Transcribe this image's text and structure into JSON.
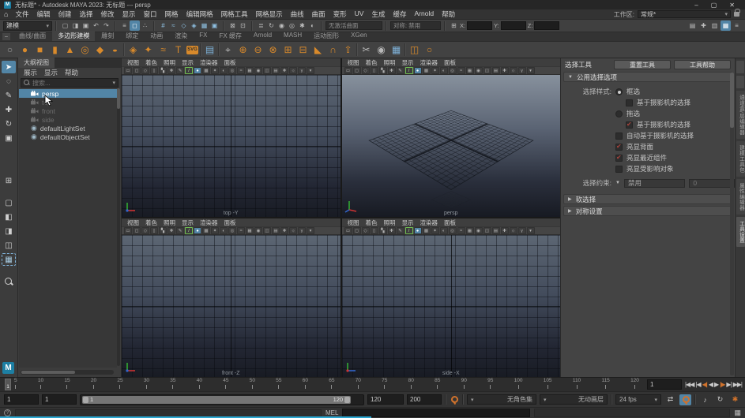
{
  "colors": {
    "accent": "#5285a6",
    "shelf_orange": "#d98a2b",
    "check_red": "#a8433c",
    "autokey_blue": "#5285a6",
    "progress_cyan": "#2ba7d1"
  },
  "title_bar": {
    "title": "无标题* - Autodesk MAYA 2023: 无标题 --- persp",
    "minimize": "–",
    "maximize": "▢",
    "close": "✕"
  },
  "menu_bar": {
    "home_icon": "⌂",
    "items": [
      "文件",
      "编辑",
      "创建",
      "选择",
      "修改",
      "显示",
      "窗口",
      "网格",
      "编辑网格",
      "网格工具",
      "网格显示",
      "曲线",
      "曲面",
      "变形",
      "UV",
      "生成",
      "缓存",
      "Arnold",
      "帮助"
    ],
    "workspace_label": "工作区:",
    "workspace_value": "常规*"
  },
  "status_line": {
    "menu_set": "建模",
    "file_icons": [
      {
        "name": "new-scene-icon",
        "glyph": "▢"
      },
      {
        "name": "open-scene-icon",
        "glyph": "◨"
      },
      {
        "name": "save-scene-icon",
        "glyph": "▣"
      },
      {
        "name": "undo-icon",
        "glyph": "↶"
      },
      {
        "name": "redo-icon",
        "glyph": "↷"
      }
    ],
    "selection_icons": [
      {
        "name": "select-by-hierarchy-icon",
        "glyph": "≡"
      },
      {
        "name": "select-by-object-icon",
        "glyph": "◻",
        "active": true
      },
      {
        "name": "select-by-component-icon",
        "glyph": "∴"
      }
    ],
    "snap_icons": [
      {
        "name": "snap-to-grids-icon",
        "glyph": "#",
        "cls": "blue"
      },
      {
        "name": "snap-to-curves-icon",
        "glyph": "≈",
        "cls": "blue"
      },
      {
        "name": "snap-to-points-icon",
        "glyph": "◇",
        "cls": "blue"
      },
      {
        "name": "snap-to-projected-center-icon",
        "glyph": "◈",
        "cls": "blue"
      },
      {
        "name": "snap-to-view-planes-icon",
        "glyph": "▦",
        "cls": "blue"
      },
      {
        "name": "make-live-icon",
        "glyph": "▣",
        "cls": "blue"
      }
    ],
    "lock_icons": [
      {
        "name": "selection-lock-icon",
        "glyph": "⊠"
      },
      {
        "name": "highlight-selection-icon",
        "glyph": "⊡"
      }
    ],
    "history_icons": [
      {
        "name": "operations-list-icon",
        "glyph": "≣"
      },
      {
        "name": "construction-history-icon",
        "glyph": "↻"
      },
      {
        "name": "render-frame-icon",
        "glyph": "◉"
      },
      {
        "name": "ipr-render-icon",
        "glyph": "◎"
      },
      {
        "name": "render-settings-icon",
        "glyph": "✱"
      },
      {
        "name": "hypershade-icon",
        "glyph": "◐"
      }
    ],
    "no_live_surface": "无激活曲面",
    "symmetry": "对称: 禁用",
    "coords_icon": "⊞",
    "x_label": "X:",
    "y_label": "Y:",
    "z_label": "Z:",
    "right_icons": [
      {
        "name": "modeling-toolkit-toggle-icon",
        "glyph": "▤"
      },
      {
        "name": "humanik-toggle-icon",
        "glyph": "✚"
      },
      {
        "name": "attribute-editor-toggle-icon",
        "glyph": "▥"
      },
      {
        "name": "tool-settings-toggle-icon",
        "glyph": "▦",
        "active": true
      },
      {
        "name": "channel-box-toggle-icon",
        "glyph": "≡"
      }
    ]
  },
  "shelf": {
    "collapse_icon": "–",
    "tabs": [
      {
        "label": "曲线/曲面"
      },
      {
        "label": "多边形建模",
        "active": true
      },
      {
        "label": "雕刻"
      },
      {
        "label": "绑定"
      },
      {
        "label": "动画"
      },
      {
        "label": "渲染"
      },
      {
        "label": "FX"
      },
      {
        "label": "FX 缓存"
      },
      {
        "label": "Arnold"
      },
      {
        "label": "MASH"
      },
      {
        "label": "运动图形"
      },
      {
        "label": "XGen"
      }
    ],
    "icons": [
      {
        "name": "shelf-options-icon",
        "glyph": "○",
        "color": "#9a9a9a"
      },
      {
        "name": "poly-sphere-icon",
        "glyph": "●"
      },
      {
        "name": "poly-cube-icon",
        "glyph": "■"
      },
      {
        "name": "poly-cylinder-icon",
        "glyph": "▮"
      },
      {
        "name": "poly-cone-icon",
        "glyph": "▲"
      },
      {
        "name": "poly-torus-icon",
        "glyph": "◎"
      },
      {
        "name": "poly-plane-icon",
        "glyph": "◆"
      },
      {
        "name": "poly-disc-icon",
        "glyph": "●",
        "cls": "flat"
      },
      {
        "cls": "sep"
      },
      {
        "name": "platonic-solid-icon",
        "glyph": "◈"
      },
      {
        "name": "sweep-mesh-icon",
        "glyph": "✦"
      },
      {
        "name": "curve-warp-icon",
        "glyph": "≈"
      },
      {
        "name": "type-tool-icon",
        "glyph": "T"
      },
      {
        "name": "svg-tool-icon",
        "glyph": "SVG",
        "cls": "badge"
      },
      {
        "cls": "sep"
      },
      {
        "name": "modeling-toolkit-icon",
        "glyph": "▤",
        "color": "#7fb2d9"
      },
      {
        "cls": "sep"
      },
      {
        "name": "construction-plane-icon",
        "glyph": "⌖",
        "color": "#b8b8b8"
      },
      {
        "name": "boolean-union-icon",
        "glyph": "⊕"
      },
      {
        "name": "boolean-difference-icon",
        "glyph": "⊖"
      },
      {
        "name": "boolean-intersection-icon",
        "glyph": "⊗"
      },
      {
        "name": "combine-icon",
        "glyph": "⊞"
      },
      {
        "name": "separate-icon",
        "glyph": "⊟"
      },
      {
        "name": "bevel-icon",
        "glyph": "◣"
      },
      {
        "name": "bridge-icon",
        "glyph": "∩"
      },
      {
        "name": "extrude-icon",
        "glyph": "⇧"
      },
      {
        "cls": "sep"
      },
      {
        "name": "multi-cut-icon",
        "glyph": "✂",
        "color": "#b8b8b8"
      },
      {
        "name": "target-weld-icon",
        "glyph": "◉",
        "color": "#b8b8b8"
      },
      {
        "name": "quad-draw-icon",
        "glyph": "▦",
        "color": "#7fb2d9"
      },
      {
        "cls": "sep"
      },
      {
        "name": "mirror-icon",
        "glyph": "◫"
      },
      {
        "name": "smooth-icon",
        "glyph": "○"
      }
    ]
  },
  "toolbox": {
    "tools": [
      {
        "name": "select-tool",
        "glyph": "➤",
        "active": true
      },
      {
        "name": "lasso-tool",
        "glyph": "◌"
      },
      {
        "name": "paint-select-tool",
        "glyph": "✎"
      },
      {
        "name": "move-tool",
        "glyph": "✚"
      },
      {
        "name": "rotate-tool",
        "glyph": "↻"
      },
      {
        "name": "scale-tool",
        "glyph": "▣"
      }
    ],
    "grid_icon": "⊞",
    "layouts": [
      {
        "name": "layout-single-pane",
        "glyph": "▢"
      },
      {
        "name": "layout-two-pane-side",
        "glyph": "◧"
      },
      {
        "name": "layout-two-pane-stacked",
        "glyph": "◨"
      },
      {
        "name": "layout-three-pane",
        "glyph": "◫"
      },
      {
        "name": "layout-four-pane",
        "glyph": "▦",
        "cls": "layout-active"
      }
    ],
    "maya_badge": "M"
  },
  "outliner": {
    "title": "大纲视图",
    "menus": [
      "展示",
      "显示",
      "帮助"
    ],
    "search_placeholder": "搜索...",
    "caret": "▾",
    "items": [
      {
        "label": "persp",
        "cls": "selected"
      },
      {
        "label": "top",
        "cls": "muted"
      },
      {
        "label": "front",
        "cls": "muted"
      },
      {
        "label": "side",
        "cls": "muted"
      },
      {
        "label": "defaultLightSet",
        "cls": "icon-set"
      },
      {
        "label": "defaultObjectSet",
        "cls": "icon-set"
      }
    ]
  },
  "viewports": {
    "menu": [
      "视图",
      "着色",
      "照明",
      "显示",
      "渲染器",
      "面板"
    ],
    "toolbar": [
      {
        "name": "select-camera-icon",
        "glyph": "▭"
      },
      {
        "name": "lock-camera-icon",
        "glyph": "◻"
      },
      {
        "name": "camera-attributes-icon",
        "glyph": "◇"
      },
      {
        "name": "bookmarks-icon",
        "glyph": "▯"
      },
      {
        "name": "image-plane-icon",
        "glyph": "▚"
      },
      {
        "name": "2d-pan-zoom-icon",
        "glyph": "✚"
      },
      {
        "name": "grease-pencil-icon",
        "glyph": "✎"
      },
      {
        "name": "wireframe-icon",
        "glyph": "/",
        "cls": "green"
      },
      {
        "name": "shaded-icon",
        "glyph": "●",
        "cls": "sel"
      },
      {
        "name": "textured-icon",
        "glyph": "▩"
      },
      {
        "name": "use-all-lights-icon",
        "glyph": "✦"
      },
      {
        "name": "shadows-icon",
        "glyph": "◐"
      },
      {
        "name": "screen-space-ao-icon",
        "glyph": "◎"
      },
      {
        "name": "motion-blur-icon",
        "glyph": "≈"
      },
      {
        "name": "multisample-icon",
        "glyph": "▦"
      },
      {
        "name": "depth-of-field-icon",
        "glyph": "◉"
      },
      {
        "name": "isolate-select-icon",
        "glyph": "◫"
      },
      {
        "name": "xray-icon",
        "glyph": "▤"
      },
      {
        "name": "joints-xray-icon",
        "glyph": "✚"
      },
      {
        "name": "exposure-icon",
        "glyph": "☼"
      },
      {
        "name": "gamma-icon",
        "glyph": "γ"
      },
      {
        "name": "view-transform-icon",
        "glyph": "▾"
      }
    ],
    "panels": [
      {
        "label": "top -Y"
      },
      {
        "label": "persp"
      },
      {
        "label": "front -Z"
      },
      {
        "label": "side -X"
      }
    ]
  },
  "tool_settings": {
    "title": "选择工具",
    "reset_label": "重置工具",
    "help_label": "工具帮助",
    "section_common": "公用选择选项",
    "selection_style_label": "选择样式:",
    "radio_marquee": {
      "label": "框选",
      "on": true
    },
    "check_marquee_camera": {
      "label": "基于摄影机的选择",
      "checked": false
    },
    "radio_drag": {
      "label": "拖选",
      "on": false
    },
    "check_drag_camera": {
      "label": "基于摄影机的选择",
      "checked": true
    },
    "check_auto_camera": {
      "label": "自动基于摄影机的选择",
      "checked": false
    },
    "check_backface": {
      "label": "亮显背面",
      "checked": true
    },
    "check_nearest": {
      "label": "亮显最近组件",
      "checked": true
    },
    "check_affected": {
      "label": "亮显受影响对象",
      "checked": false
    },
    "constraint_label": "选择约束:",
    "constraint_value": "禁用",
    "constraint_num": "0",
    "section_soft": "软选择",
    "section_sym": "对称设置"
  },
  "sidebar_tabs": [
    {
      "label": "通道盒/层编辑器"
    },
    {
      "label": "建模工具包"
    },
    {
      "label": "属性编辑器"
    },
    {
      "label": "工具设置",
      "active": true
    }
  ],
  "time_slider": {
    "ticks": [
      "5",
      "10",
      "15",
      "20",
      "25",
      "30",
      "35",
      "40",
      "45",
      "50",
      "55",
      "60",
      "65",
      "70",
      "75",
      "80",
      "85",
      "90",
      "95",
      "100",
      "105",
      "110",
      "115",
      "120"
    ],
    "current_frame": "1",
    "frame_field_value": "1"
  },
  "playback": {
    "buttons": [
      {
        "name": "go-to-start-button",
        "glyph": "|◀◀"
      },
      {
        "name": "step-back-frame-button",
        "glyph": "|◀"
      },
      {
        "name": "step-back-key-button",
        "glyph": "◀|",
        "cls": "orange"
      },
      {
        "name": "play-backwards-button",
        "glyph": "◀"
      },
      {
        "name": "play-forwards-button",
        "glyph": "▶"
      },
      {
        "name": "step-forward-key-button",
        "glyph": "|▶",
        "cls": "orange"
      },
      {
        "name": "step-forward-frame-button",
        "glyph": "▶|"
      },
      {
        "name": "go-to-end-button",
        "glyph": "▶▶|"
      }
    ]
  },
  "range_slider": {
    "playback_start": "1",
    "anim_start": "1",
    "bar_start_label": "1",
    "bar_end_label": "120",
    "anim_end": "120",
    "playback_end": "200",
    "character_set": "无角色集",
    "anim_layer": "无动画层",
    "fps": "24 fps",
    "loop_glyph": "⇄",
    "mute_glyph": "♪",
    "cache_glyph": "↻",
    "prefs_glyph": "✱"
  },
  "command_line": {
    "help_icon": "?",
    "mel_label": "MEL",
    "script_editor_glyph": "▦"
  }
}
